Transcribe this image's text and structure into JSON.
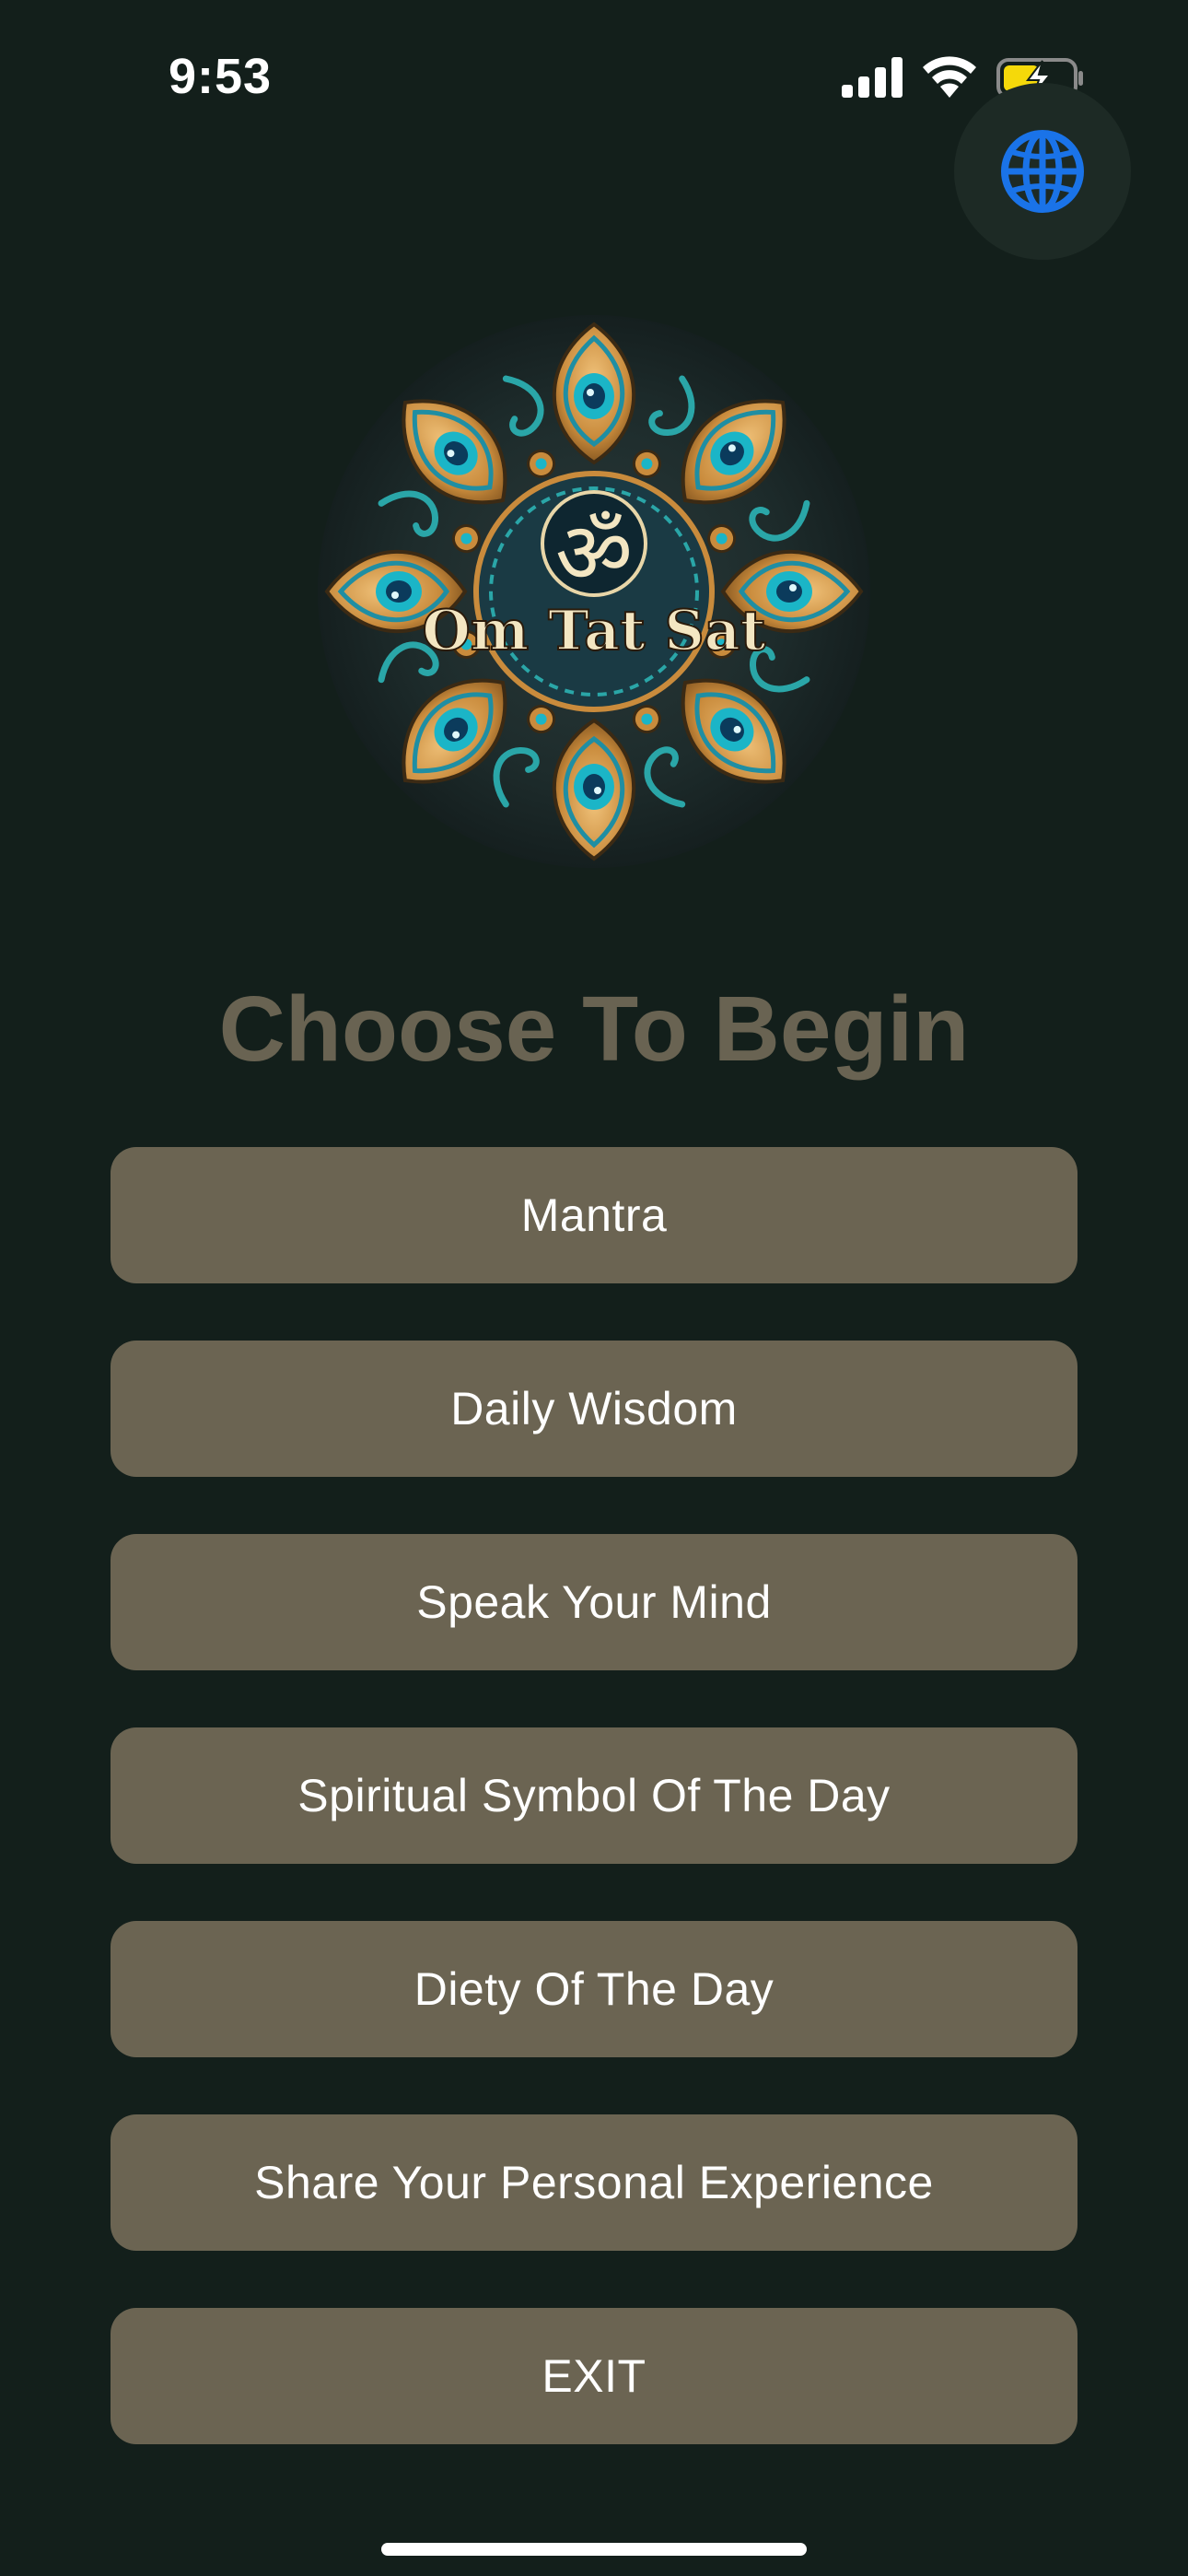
{
  "status_bar": {
    "time": "9:53",
    "icons": [
      "signal-icon",
      "wifi-icon",
      "battery-charging-icon"
    ]
  },
  "globe_button": {
    "icon": "globe-icon",
    "color": "#1a73e8"
  },
  "logo": {
    "text": "Om Tat Sat",
    "symbol": "ॐ"
  },
  "heading": "Choose To Begin",
  "menu": {
    "items": [
      {
        "label": "Mantra"
      },
      {
        "label": "Daily Wisdom"
      },
      {
        "label": "Speak Your Mind"
      },
      {
        "label": "Spiritual Symbol Of The Day"
      },
      {
        "label": "Diety Of The Day"
      },
      {
        "label": "Share Your Personal Experience"
      },
      {
        "label": "EXIT"
      }
    ]
  },
  "colors": {
    "background": "#131f1b",
    "button": "#6b6452",
    "heading": "#696352",
    "accent": "#1a73e8"
  }
}
